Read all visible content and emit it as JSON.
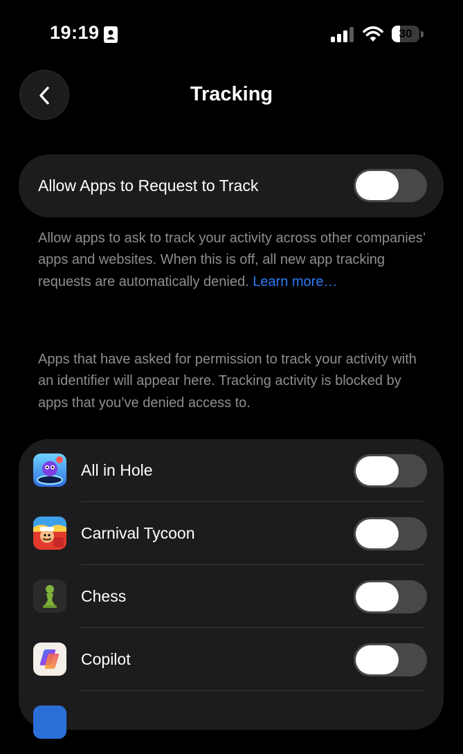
{
  "status_bar": {
    "time": "19:19",
    "battery_percent": "30",
    "battery_level": 0.3
  },
  "header": {
    "title": "Tracking",
    "back_icon": "chevron-left-icon"
  },
  "main_toggle": {
    "label": "Allow Apps to Request to Track",
    "on": false
  },
  "description": {
    "text": "Allow apps to ask to track your activity across other companies’ apps and websites. When this is off, all new app tracking requests are automatically denied. ",
    "link": "Learn more…"
  },
  "info_text": "Apps that have asked for permission to track your activity with an identifier will appear here. Tracking activity is blocked by apps that you’ve denied access to.",
  "apps": [
    {
      "name": "All in Hole",
      "icon": "all-in-hole-app-icon",
      "on": false
    },
    {
      "name": "Carnival Tycoon",
      "icon": "carnival-tycoon-app-icon",
      "on": false
    },
    {
      "name": "Chess",
      "icon": "chess-app-icon",
      "on": false
    },
    {
      "name": "Copilot",
      "icon": "copilot-app-icon",
      "on": false
    }
  ],
  "colors": {
    "background": "#000000",
    "card": "#1c1c1e",
    "toggle_off": "#48484a",
    "secondary_text": "#8e8e93",
    "link": "#2f7cf6"
  }
}
